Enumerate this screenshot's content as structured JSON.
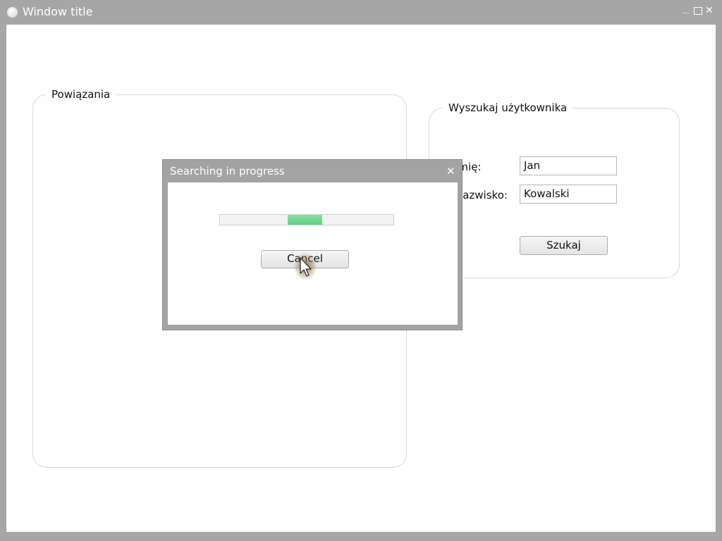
{
  "window": {
    "title": "Window title",
    "close_glyph": "✕"
  },
  "left_group": {
    "legend": "Powiązania"
  },
  "search_group": {
    "legend": "Wyszukaj użytkownika",
    "first_name_label": "Imię:",
    "first_name_value": "Jan",
    "last_name_label": "Nazwisko:",
    "last_name_value": "Kowalski",
    "search_button": "Szukaj"
  },
  "dialog": {
    "title": "Searching in progress",
    "close_glyph": "✕",
    "progress": {
      "indeterminate": true,
      "segment_start": 0.39,
      "segment_width": 0.2
    },
    "cancel_button": "Cancel"
  },
  "colors": {
    "chrome": "#a6a6a6",
    "progress_green": "#5fcf82"
  },
  "icons": {
    "app": "circle-app-icon",
    "minimize": "minimize-icon",
    "maximize": "maximize-icon",
    "close": "close-icon",
    "cursor": "mouse-pointer-icon"
  }
}
